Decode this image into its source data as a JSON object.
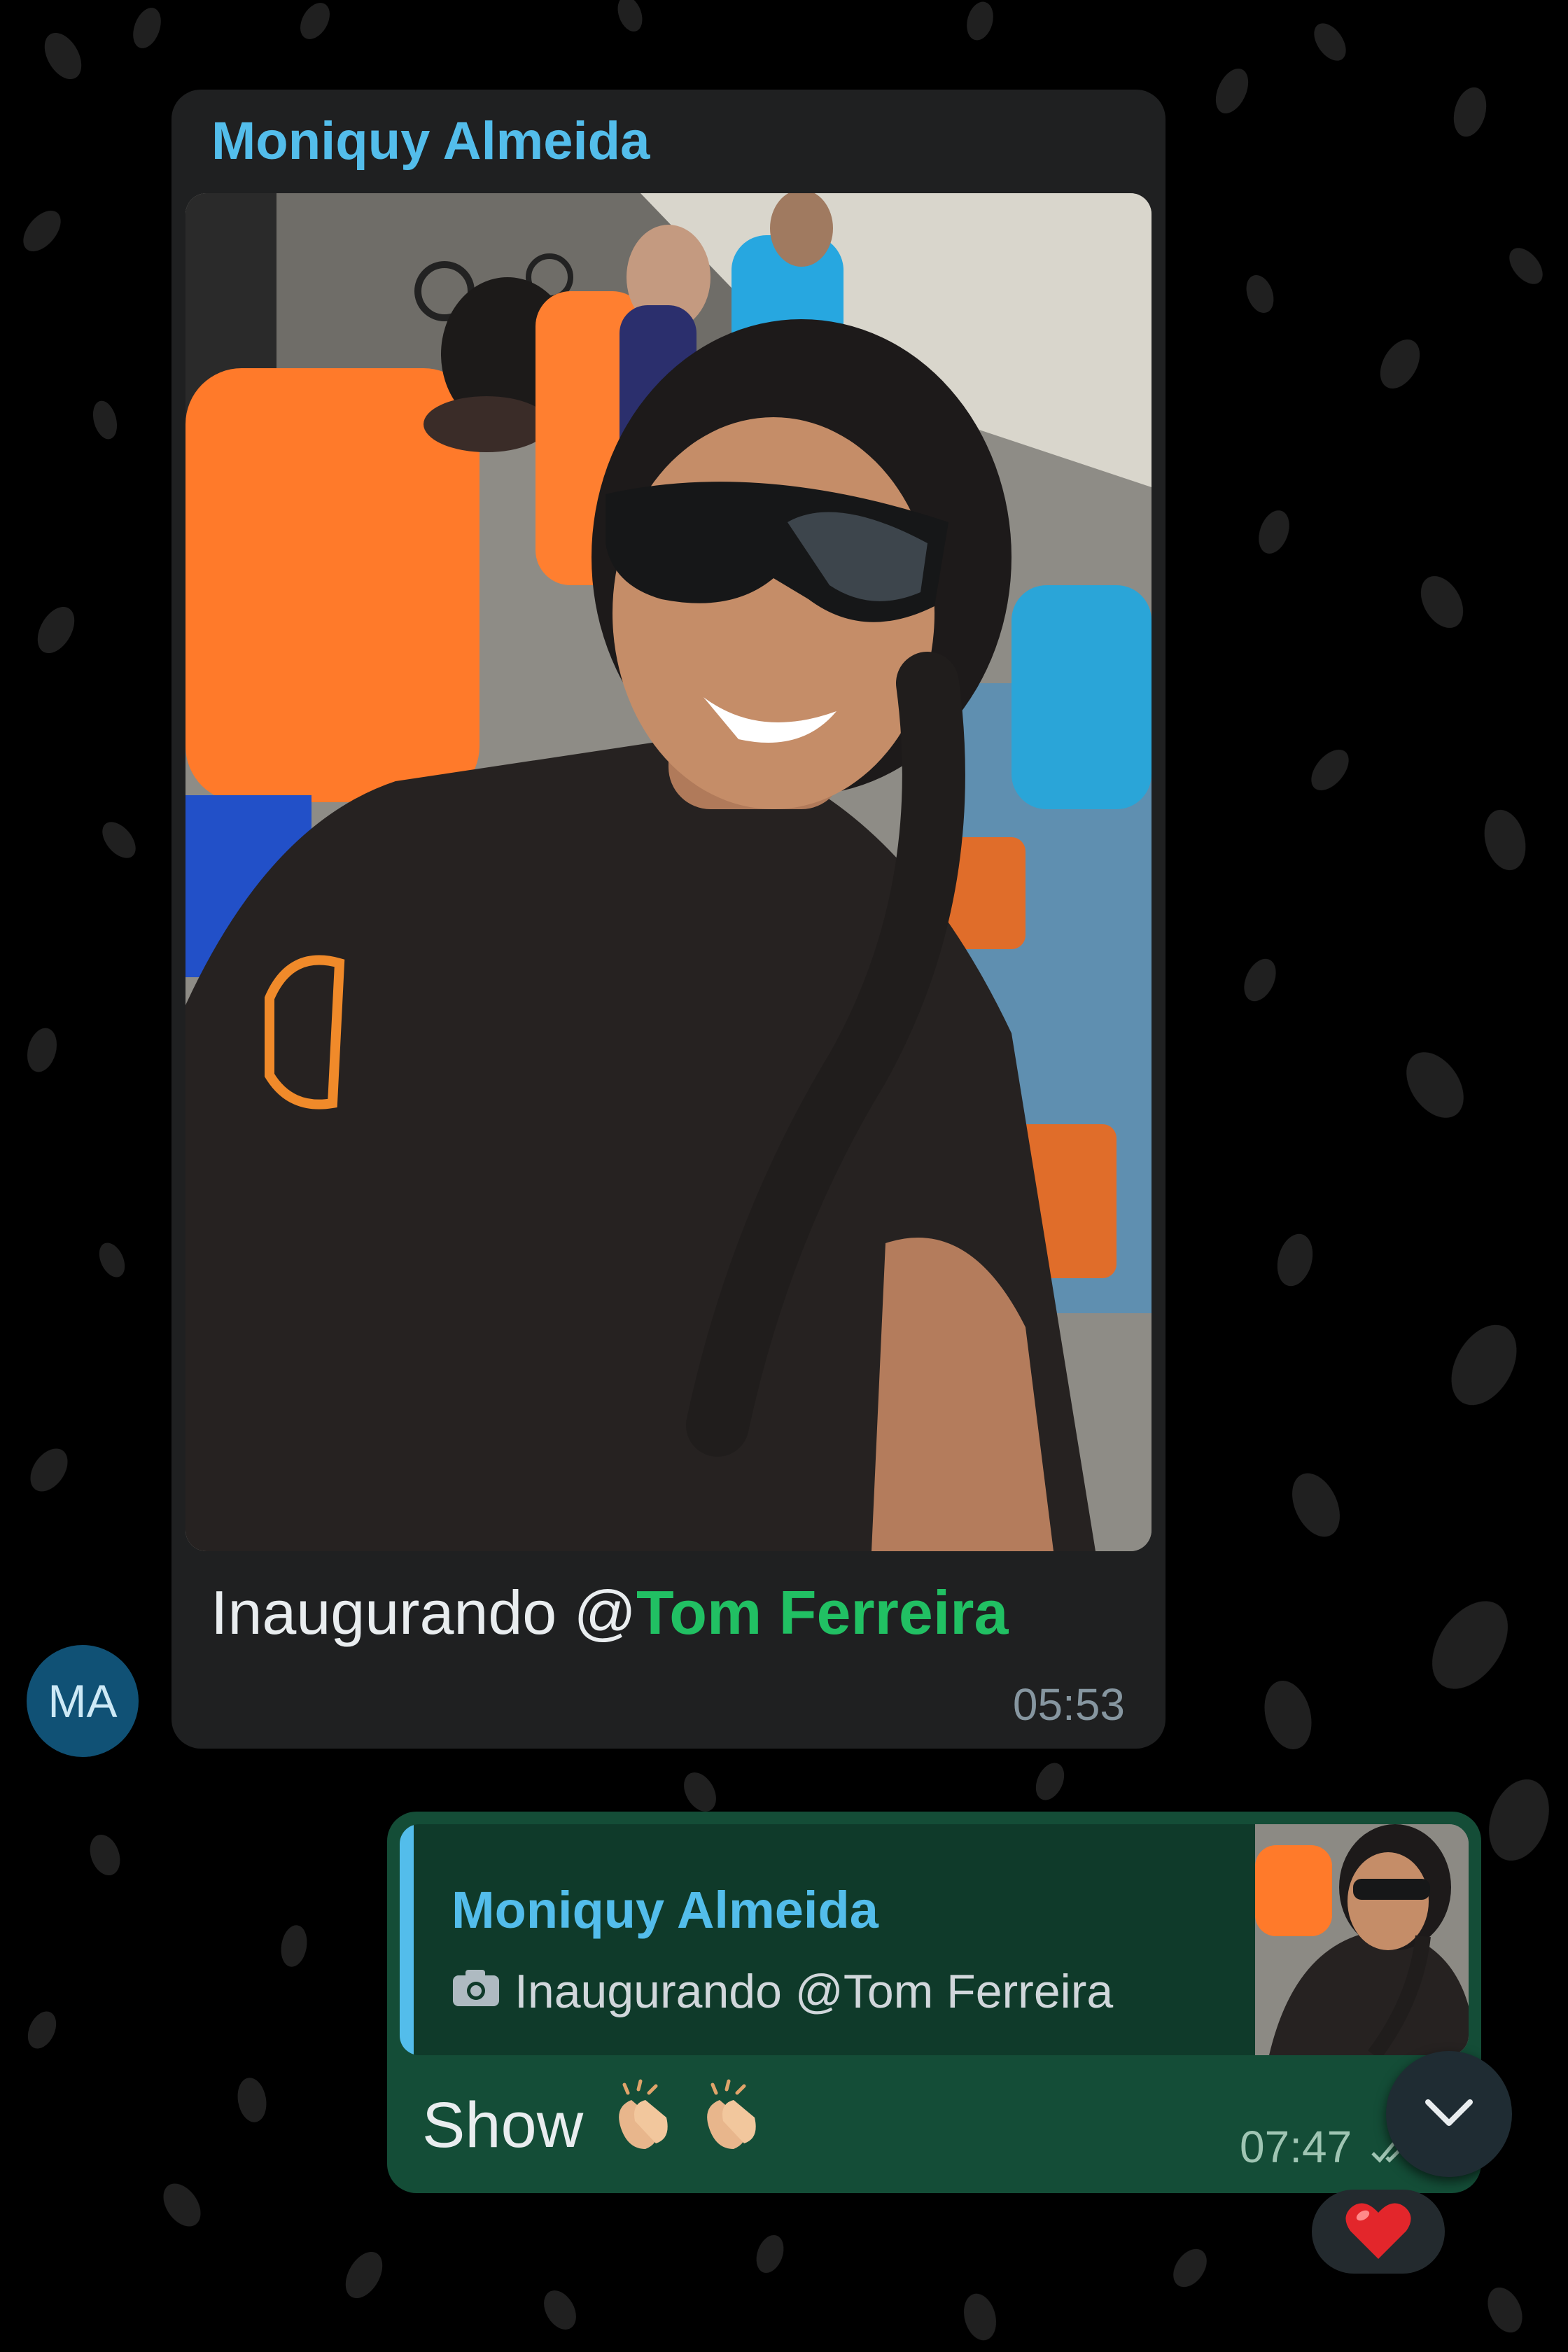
{
  "incoming": {
    "sender": "Moniquy Almeida",
    "caption_text": "Inaugurando @",
    "mention": "Tom Ferreira",
    "time": "05:53",
    "avatar_initials": "MA"
  },
  "outgoing": {
    "quote_sender": "Moniquy Almeida",
    "quote_text": "Inaugurando @Tom Ferreira",
    "message": "Show",
    "emojis": [
      "clapping-hands",
      "clapping-hands"
    ],
    "time": "07:47",
    "status": "read"
  },
  "reaction": "red-heart",
  "colors": {
    "incoming_bubble": "#1f2021",
    "outgoing_bubble": "#144d37",
    "name_accent": "#53bdeb",
    "mention": "#21c063"
  },
  "icons": [
    "camera-icon",
    "chevron-down-icon",
    "double-check-icon",
    "heart-icon"
  ]
}
